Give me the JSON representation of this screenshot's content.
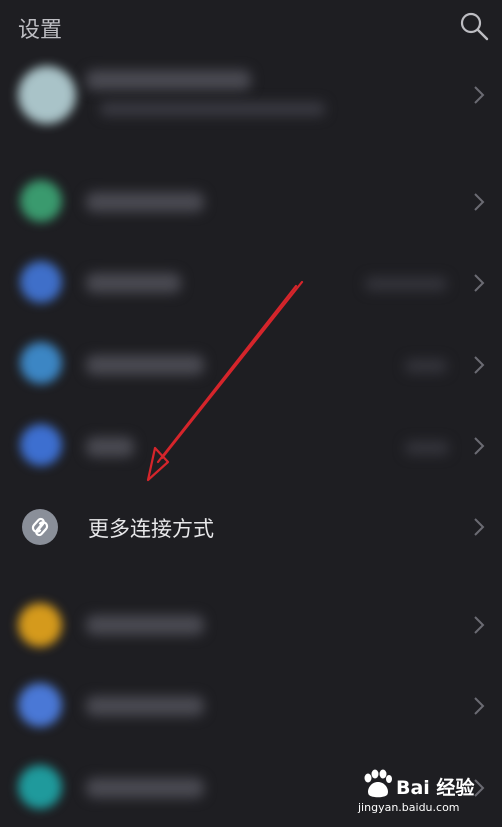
{
  "header": {
    "title": "设置",
    "search_icon": "search-icon"
  },
  "rows": {
    "more_connections": {
      "label": "更多连接方式",
      "icon": "link-icon"
    }
  },
  "colors": {
    "background": "#1e1e22",
    "profile": "#a9c3c8",
    "green": "#3a9a6e",
    "blue1": "#3f6fc9",
    "blue2": "#3c86c4",
    "blue3": "#3d6fd0",
    "yellow": "#d59a1c",
    "blue4": "#4a78d6",
    "teal": "#1f9a9c",
    "annotation_arrow": "#d5252b"
  },
  "watermark": {
    "brand": "Bai  经验",
    "url": "jingyan.baidu.com"
  }
}
